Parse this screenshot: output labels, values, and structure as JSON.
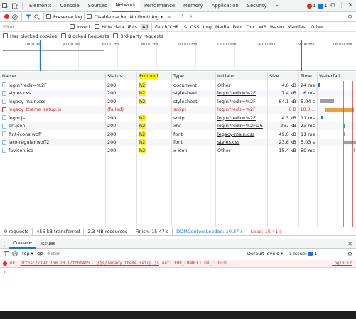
{
  "tabs": [
    "Elements",
    "Console",
    "Sources",
    "Network",
    "Performance",
    "Memory",
    "Application",
    "Security"
  ],
  "tabs_more": "»",
  "badges": {
    "errors": "1",
    "issues": "1"
  },
  "toolbar": {
    "preserve_log": "Preserve log",
    "disable_cache": "Disable cache",
    "throttling": "No throttling"
  },
  "filter": {
    "placeholder": "Filter",
    "invert": "Invert",
    "hide_data_urls": "Hide data URLs",
    "types": [
      "All",
      "Fetch/XHR",
      "JS",
      "CSS",
      "Img",
      "Media",
      "Font",
      "Doc",
      "WS",
      "Wasm",
      "Manifest",
      "Other"
    ],
    "has_blocked_cookies": "Has blocked cookies",
    "blocked_requests": "Blocked Requests",
    "third_party": "3rd-party requests"
  },
  "overview": {
    "ticks": [
      "2000 ms",
      "4000 ms",
      "6000 ms",
      "8000 ms",
      "10000 ms",
      "12000 ms",
      "14000 ms",
      "16000 ms",
      "18000 ms"
    ]
  },
  "columns": [
    "Name",
    "Status",
    "Protocol",
    "Type",
    "Initiator",
    "Size",
    "Time",
    "Waterfall"
  ],
  "requests": [
    {
      "name": "login?redir=%2F",
      "status": "200",
      "protocol": "h2",
      "type": "document",
      "initiator": "Other",
      "size": "4.6 kB",
      "time": "24 ms",
      "failed": false,
      "init_link": false
    },
    {
      "name": "styles.css",
      "status": "200",
      "protocol": "h2",
      "type": "stylesheet",
      "initiator": "login?redir=%2F",
      "size": "7.4 kB",
      "time": "6 ms",
      "failed": false,
      "init_link": true
    },
    {
      "name": "legacy-main.css",
      "status": "200",
      "protocol": "h2",
      "type": "stylesheet",
      "initiator": "login?redir=%2F",
      "size": "84.1 kB",
      "time": "5.04 s",
      "failed": false,
      "init_link": true
    },
    {
      "name": "legacy_theme_setup.js",
      "status": "(failed)",
      "protocol": "",
      "type": "script",
      "initiator": "login?redir=%2F",
      "size": "0 B",
      "time": "10.0...",
      "failed": true,
      "init_link": true
    },
    {
      "name": "login.js",
      "status": "200",
      "protocol": "h2",
      "type": "script",
      "initiator": "login?redir=%2F",
      "size": "4.3 kB",
      "time": "11 ms",
      "failed": false,
      "init_link": true
    },
    {
      "name": "en.json",
      "status": "200",
      "protocol": "h2",
      "type": "xhr",
      "initiator": "login?redir=%2F:26",
      "size": "267 kB",
      "time": "23 ms",
      "failed": false,
      "init_link": true
    },
    {
      "name": "ftnt-icons.woff",
      "status": "200",
      "protocol": "h2",
      "type": "font",
      "initiator": "legacy-main.css",
      "size": "49.0 kB",
      "time": "11 ms",
      "failed": false,
      "init_link": true
    },
    {
      "name": "lato-regular.woff2",
      "status": "200",
      "protocol": "h2",
      "type": "font",
      "initiator": "styles.css",
      "size": "23.8 kB",
      "time": "5.03 s",
      "failed": false,
      "init_link": true
    },
    {
      "name": "favicon.ico",
      "status": "200",
      "protocol": "h2",
      "type": "x-icon",
      "initiator": "Other",
      "size": "15.4 kB",
      "time": "59 ms",
      "failed": false,
      "init_link": false
    }
  ],
  "status_bar": {
    "requests": "9 requests",
    "transferred": "456 kB transferred",
    "resources": "2.3 MB resources",
    "finish": "Finish: 15.47 s",
    "dcl": "DOMContentLoaded: 10.37 s",
    "load": "Load: 15.41 s"
  },
  "drawer": {
    "tabs": [
      "Console",
      "Issues"
    ],
    "context": "top",
    "filter_placeholder": "Filter",
    "levels": "Default levels",
    "issues": "1 Issue:",
    "issues_count": "1"
  },
  "console_error": {
    "method": "GET",
    "url": "https://192.168.20.1/ffbf4b5.../js/legacy_theme_setup.js",
    "error": "net::ERR_CONNECTION_CLOSED",
    "source": "login:12"
  },
  "colors": {
    "accent": "#1a73e8",
    "error": "#d93025",
    "highlight": "#fff200"
  }
}
